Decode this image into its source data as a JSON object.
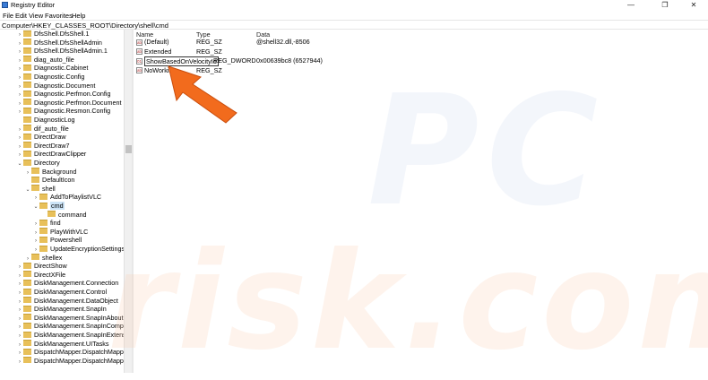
{
  "window": {
    "title": "Registry Editor",
    "minimize_glyph": "—",
    "maximize_glyph": "❐",
    "close_glyph": "✕"
  },
  "menu": [
    "File",
    "Edit",
    "View",
    "Favorites",
    "Help"
  ],
  "address": "Computer\\HKEY_CLASSES_ROOT\\Directory\\shell\\cmd",
  "tree": [
    {
      "label": "DfsShell.DfsShell.1",
      "expander": ">",
      "level": 0
    },
    {
      "label": "DfsShell.DfsShellAdmin",
      "expander": ">",
      "level": 0
    },
    {
      "label": "DfsShell.DfsShellAdmin.1",
      "expander": ">",
      "level": 0
    },
    {
      "label": "diag_auto_file",
      "expander": ">",
      "level": 0
    },
    {
      "label": "Diagnostic.Cabinet",
      "expander": ">",
      "level": 0
    },
    {
      "label": "Diagnostic.Config",
      "expander": ">",
      "level": 0
    },
    {
      "label": "Diagnostic.Document",
      "expander": ">",
      "level": 0
    },
    {
      "label": "Diagnostic.Perfmon.Config",
      "expander": ">",
      "level": 0
    },
    {
      "label": "Diagnostic.Perfmon.Document",
      "expander": ">",
      "level": 0
    },
    {
      "label": "Diagnostic.Resmon.Config",
      "expander": ">",
      "level": 0
    },
    {
      "label": "DiagnosticLog",
      "expander": "",
      "level": 0
    },
    {
      "label": "dif_auto_file",
      "expander": ">",
      "level": 0
    },
    {
      "label": "DirectDraw",
      "expander": ">",
      "level": 0
    },
    {
      "label": "DirectDraw7",
      "expander": ">",
      "level": 0
    },
    {
      "label": "DirectDrawClipper",
      "expander": ">",
      "level": 0
    },
    {
      "label": "Directory",
      "expander": "v",
      "level": 0
    },
    {
      "label": "Background",
      "expander": ">",
      "level": 1
    },
    {
      "label": "DefaultIcon",
      "expander": "",
      "level": 1
    },
    {
      "label": "shell",
      "expander": "v",
      "level": 1
    },
    {
      "label": "AddToPlaylistVLC",
      "expander": ">",
      "level": 2
    },
    {
      "label": "cmd",
      "expander": "v",
      "level": 2,
      "selected": true
    },
    {
      "label": "command",
      "expander": "",
      "level": 3
    },
    {
      "label": "find",
      "expander": ">",
      "level": 2
    },
    {
      "label": "PlayWithVLC",
      "expander": ">",
      "level": 2
    },
    {
      "label": "Powershell",
      "expander": ">",
      "level": 2
    },
    {
      "label": "UpdateEncryptionSettings",
      "expander": ">",
      "level": 2
    },
    {
      "label": "shellex",
      "expander": ">",
      "level": 1
    },
    {
      "label": "DirectShow",
      "expander": ">",
      "level": 0
    },
    {
      "label": "DirectXFile",
      "expander": ">",
      "level": 0
    },
    {
      "label": "DiskManagement.Connection",
      "expander": ">",
      "level": 0
    },
    {
      "label": "DiskManagement.Control",
      "expander": ">",
      "level": 0
    },
    {
      "label": "DiskManagement.DataObject",
      "expander": ">",
      "level": 0
    },
    {
      "label": "DiskManagement.SnapIn",
      "expander": ">",
      "level": 0
    },
    {
      "label": "DiskManagement.SnapInAbout",
      "expander": ">",
      "level": 0
    },
    {
      "label": "DiskManagement.SnapInCompon",
      "expander": ">",
      "level": 0
    },
    {
      "label": "DiskManagement.SnapInExtensic",
      "expander": ">",
      "level": 0
    },
    {
      "label": "DiskManagement.UITasks",
      "expander": ">",
      "level": 0
    },
    {
      "label": "DispatchMapper.DispatchMapper",
      "expander": ">",
      "level": 0
    },
    {
      "label": "DispatchMapper.DispatchMappe",
      "expander": ">",
      "level": 0
    }
  ],
  "values_header": {
    "name": "Name",
    "type": "Type",
    "data": "Data"
  },
  "values": [
    {
      "icon": "ab",
      "name": "(Default)",
      "type": "REG_SZ",
      "data": "@shell32.dll,-8506"
    },
    {
      "icon": "ab",
      "name": "Extended",
      "type": "REG_SZ",
      "data": ""
    },
    {
      "icon": "01",
      "name": "ShowBasedOnVelocityId",
      "type": "REG_DWORD",
      "data": "0x00639bc8 (6527944)",
      "editing": true
    },
    {
      "icon": "ab",
      "name": "NoWorking",
      "type": "REG_SZ",
      "data": ""
    }
  ],
  "arrow_color": "#f26b1d",
  "watermark": {
    "top": "PC",
    "bottom": "risk.com"
  }
}
